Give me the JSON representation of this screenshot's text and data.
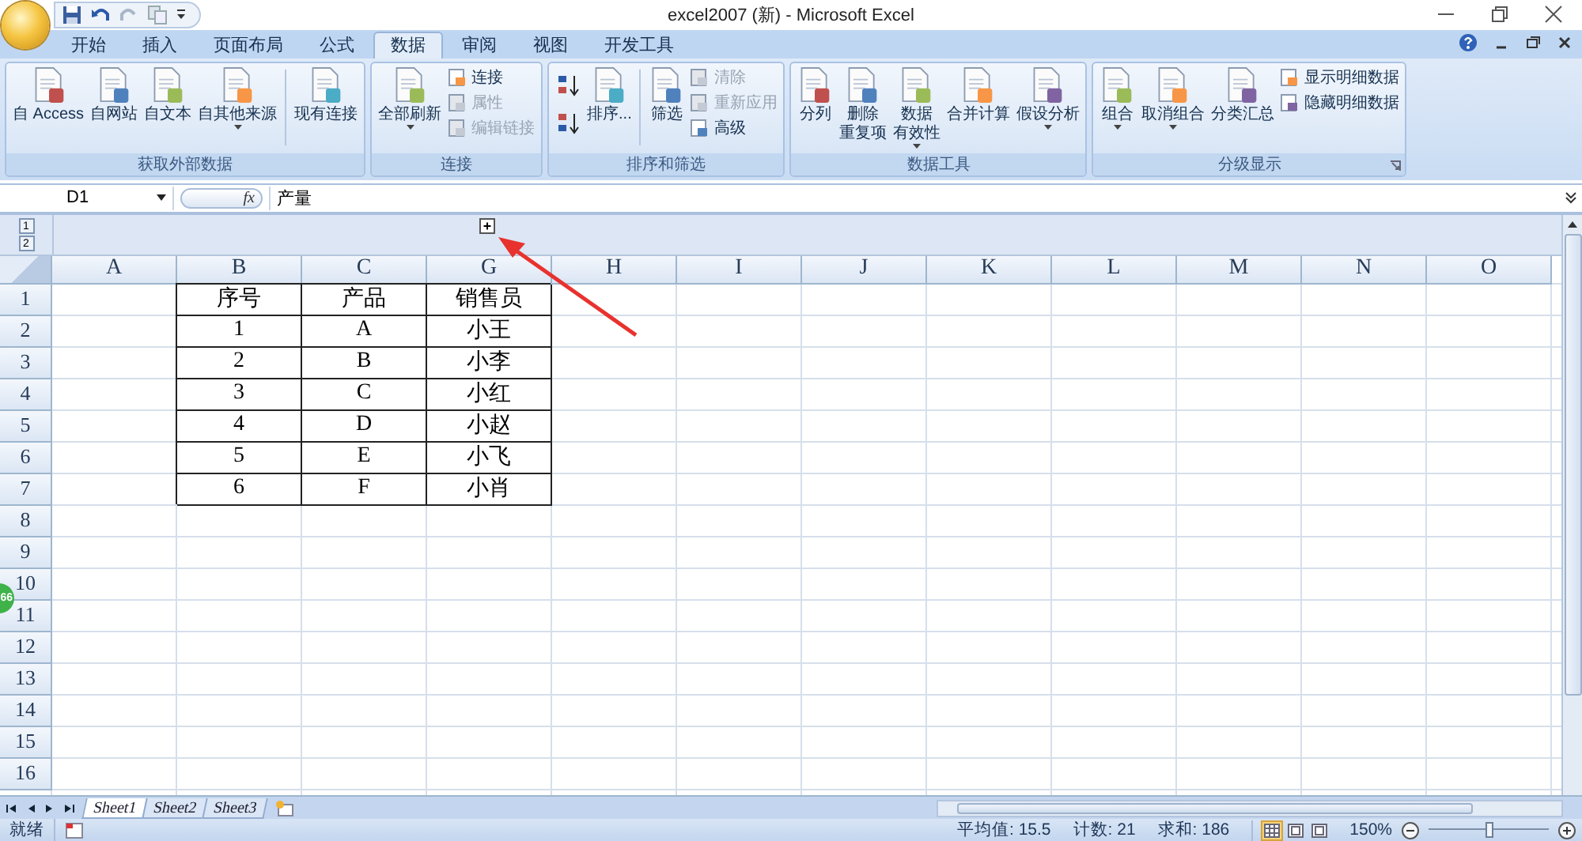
{
  "window": {
    "title": "excel2007 (新) - Microsoft Excel"
  },
  "tabs": [
    {
      "label": "开始",
      "selected": false
    },
    {
      "label": "插入",
      "selected": false
    },
    {
      "label": "页面布局",
      "selected": false
    },
    {
      "label": "公式",
      "selected": false
    },
    {
      "label": "数据",
      "selected": true
    },
    {
      "label": "审阅",
      "selected": false
    },
    {
      "label": "视图",
      "selected": false
    },
    {
      "label": "开发工具",
      "selected": false
    }
  ],
  "ribbon": [
    {
      "title": "获取外部数据",
      "commands": [
        {
          "kind": "large",
          "lines": [
            "自 Access"
          ],
          "dropdown": false
        },
        {
          "kind": "large",
          "lines": [
            "自网站"
          ],
          "dropdown": false
        },
        {
          "kind": "large",
          "lines": [
            "自文本"
          ],
          "dropdown": false
        },
        {
          "kind": "large",
          "lines": [
            "自其他来源"
          ],
          "dropdown": true
        },
        {
          "kind": "separator"
        },
        {
          "kind": "large",
          "lines": [
            "现有连接"
          ],
          "dropdown": false
        }
      ]
    },
    {
      "title": "连接",
      "commands": [
        {
          "kind": "large",
          "lines": [
            "全部刷新"
          ],
          "dropdown": true
        },
        {
          "kind": "stack",
          "items": [
            {
              "label": "连接",
              "disabled": false
            },
            {
              "label": "属性",
              "disabled": true
            },
            {
              "label": "编辑链接",
              "disabled": true
            }
          ]
        }
      ]
    },
    {
      "title": "排序和筛选",
      "commands": [
        {
          "kind": "sort-pair"
        },
        {
          "kind": "large",
          "lines": [
            "排序..."
          ],
          "dropdown": false
        },
        {
          "kind": "separator"
        },
        {
          "kind": "large",
          "lines": [
            "筛选"
          ],
          "dropdown": false
        },
        {
          "kind": "stack",
          "items": [
            {
              "label": "清除",
              "disabled": true
            },
            {
              "label": "重新应用",
              "disabled": true
            },
            {
              "label": "高级",
              "disabled": false
            }
          ]
        }
      ]
    },
    {
      "title": "数据工具",
      "commands": [
        {
          "kind": "large",
          "lines": [
            "分列"
          ],
          "dropdown": false
        },
        {
          "kind": "large",
          "lines": [
            "删除",
            "重复项"
          ],
          "dropdown": false
        },
        {
          "kind": "large",
          "lines": [
            "数据",
            "有效性"
          ],
          "dropdown": true
        },
        {
          "kind": "large",
          "lines": [
            "合并计算"
          ],
          "dropdown": false
        },
        {
          "kind": "large",
          "lines": [
            "假设分析"
          ],
          "dropdown": true
        }
      ]
    },
    {
      "title": "分级显示",
      "launcher": true,
      "commands": [
        {
          "kind": "large",
          "lines": [
            "组合"
          ],
          "dropdown": true
        },
        {
          "kind": "large",
          "lines": [
            "取消组合"
          ],
          "dropdown": true
        },
        {
          "kind": "large",
          "lines": [
            "分类汇总"
          ],
          "dropdown": false
        },
        {
          "kind": "stack",
          "items": [
            {
              "label": "显示明细数据",
              "disabled": false
            },
            {
              "label": "隐藏明细数据",
              "disabled": false
            }
          ]
        }
      ]
    }
  ],
  "formula_bar": {
    "name_box": "D1",
    "fx": "fx",
    "value": "产量"
  },
  "outline": {
    "levels": [
      "1",
      "2"
    ],
    "expand_button": "+"
  },
  "columns": [
    "A",
    "B",
    "C",
    "G",
    "H",
    "I",
    "J",
    "K",
    "L",
    "M",
    "N",
    "O"
  ],
  "rows": [
    {
      "header": "1",
      "cells": {
        "B": "序号",
        "C": "产品",
        "G": "销售员"
      }
    },
    {
      "header": "2",
      "cells": {
        "B": "1",
        "C": "A",
        "G": "小王"
      }
    },
    {
      "header": "3",
      "cells": {
        "B": "2",
        "C": "B",
        "G": "小李"
      }
    },
    {
      "header": "4",
      "cells": {
        "B": "3",
        "C": "C",
        "G": "小红"
      }
    },
    {
      "header": "5",
      "cells": {
        "B": "4",
        "C": "D",
        "G": "小赵"
      }
    },
    {
      "header": "6",
      "cells": {
        "B": "5",
        "C": "E",
        "G": "小飞"
      }
    },
    {
      "header": "7",
      "cells": {
        "B": "6",
        "C": "F",
        "G": "小肖"
      }
    },
    {
      "header": "8"
    },
    {
      "header": "9"
    },
    {
      "header": "10"
    },
    {
      "header": "11"
    },
    {
      "header": "12"
    },
    {
      "header": "13"
    },
    {
      "header": "14"
    },
    {
      "header": "15"
    },
    {
      "header": "16"
    }
  ],
  "sheets": [
    {
      "label": "Sheet1",
      "selected": true
    },
    {
      "label": "Sheet2",
      "selected": false
    },
    {
      "label": "Sheet3",
      "selected": false
    }
  ],
  "status_bar": {
    "text": "就绪",
    "stats": [
      "平均值: 15.5",
      "计数: 21",
      "求和: 186"
    ],
    "views": [
      {
        "selected": true
      },
      {
        "selected": false
      },
      {
        "selected": false
      }
    ],
    "zoom": "150%",
    "zoom_slider": {
      "level": 0.5
    }
  },
  "badge": {
    "text": "66"
  }
}
